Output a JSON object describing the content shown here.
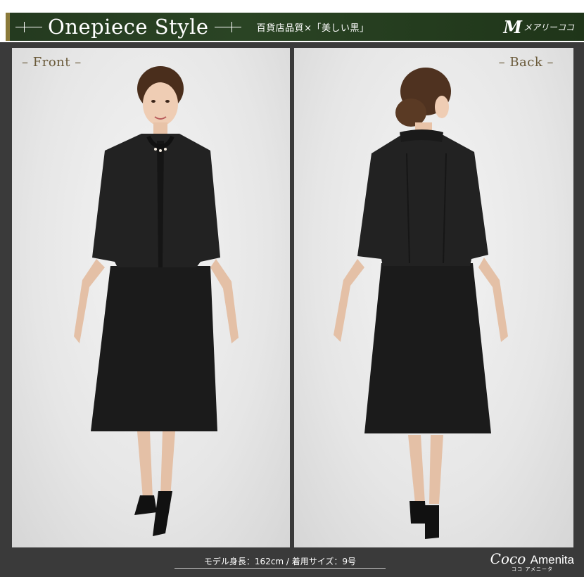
{
  "header": {
    "title": "Onepiece Style",
    "subtitle": "百貨店品質×「美しい黒」",
    "brand_mark": "M",
    "brand_name": "メアリーココ"
  },
  "panels": {
    "front_label": "– Front –",
    "back_label": "– Back –"
  },
  "caption": {
    "model_info": "モデル身長：162cm / 着用サイズ：9号"
  },
  "logo": {
    "word1": "Coco",
    "word2": "Amenita",
    "kana1": "ココ",
    "kana2": "アメニータ"
  },
  "colors": {
    "banner_green": "#2a4424",
    "banner_accent": "#8a7a3a",
    "stage_background": "#3a3a3a",
    "label_color": "#6a5a3a",
    "garment_black": "#1b1b1b"
  },
  "images": {
    "front": "model wearing black ensemble, front view",
    "back": "model wearing black ensemble, back view"
  }
}
